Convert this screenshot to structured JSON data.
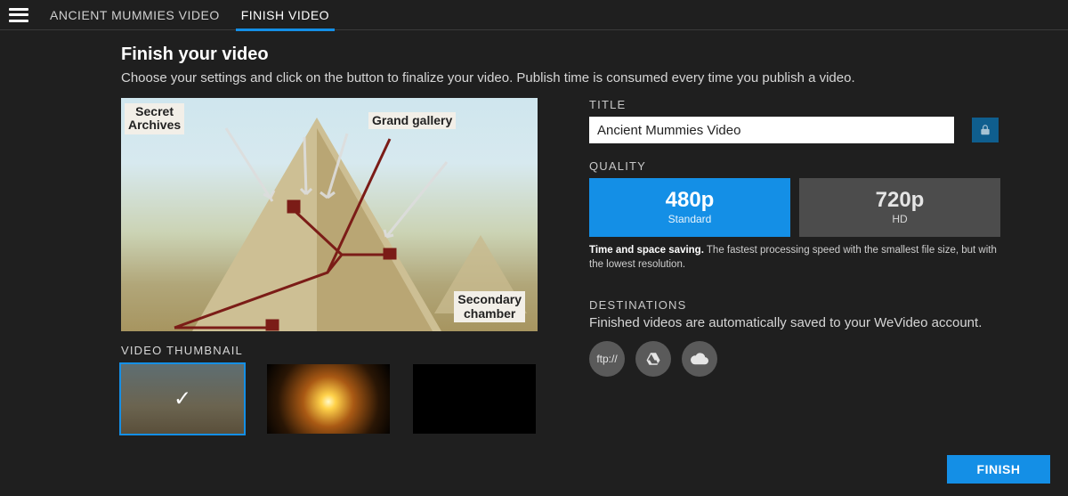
{
  "tabs": [
    {
      "label": "ANCIENT MUMMIES VIDEO"
    },
    {
      "label": "FINISH VIDEO"
    }
  ],
  "page": {
    "title": "Finish your video",
    "description": "Choose your settings and click on the button to finalize your video. Publish time is consumed every time you publish a video."
  },
  "preview": {
    "label_secret_1": "Secret",
    "label_secret_2": "Archives",
    "label_grand": "Grand gallery",
    "label_secondary_1": "Secondary",
    "label_secondary_2": "chamber"
  },
  "thumbnail": {
    "header": "VIDEO THUMBNAIL",
    "items": [
      {
        "name": "thumb-pyramid",
        "selected": true
      },
      {
        "name": "thumb-starburst",
        "selected": false
      },
      {
        "name": "thumb-black",
        "selected": false
      }
    ]
  },
  "title_section": {
    "label": "TITLE",
    "value": "Ancient Mummies Video"
  },
  "quality": {
    "label": "QUALITY",
    "options": [
      {
        "res": "480p",
        "sub": "Standard",
        "selected": true
      },
      {
        "res": "720p",
        "sub": "HD",
        "selected": false
      }
    ],
    "note_strong": "Time and space saving.",
    "note_rest": " The fastest processing speed with the smallest file size, but with the lowest resolution."
  },
  "destinations": {
    "label": "DESTINATIONS",
    "desc": "Finished videos are automatically saved to your WeVideo account.",
    "ftp_label": "ftp://"
  },
  "finish": {
    "label": "FINISH"
  }
}
